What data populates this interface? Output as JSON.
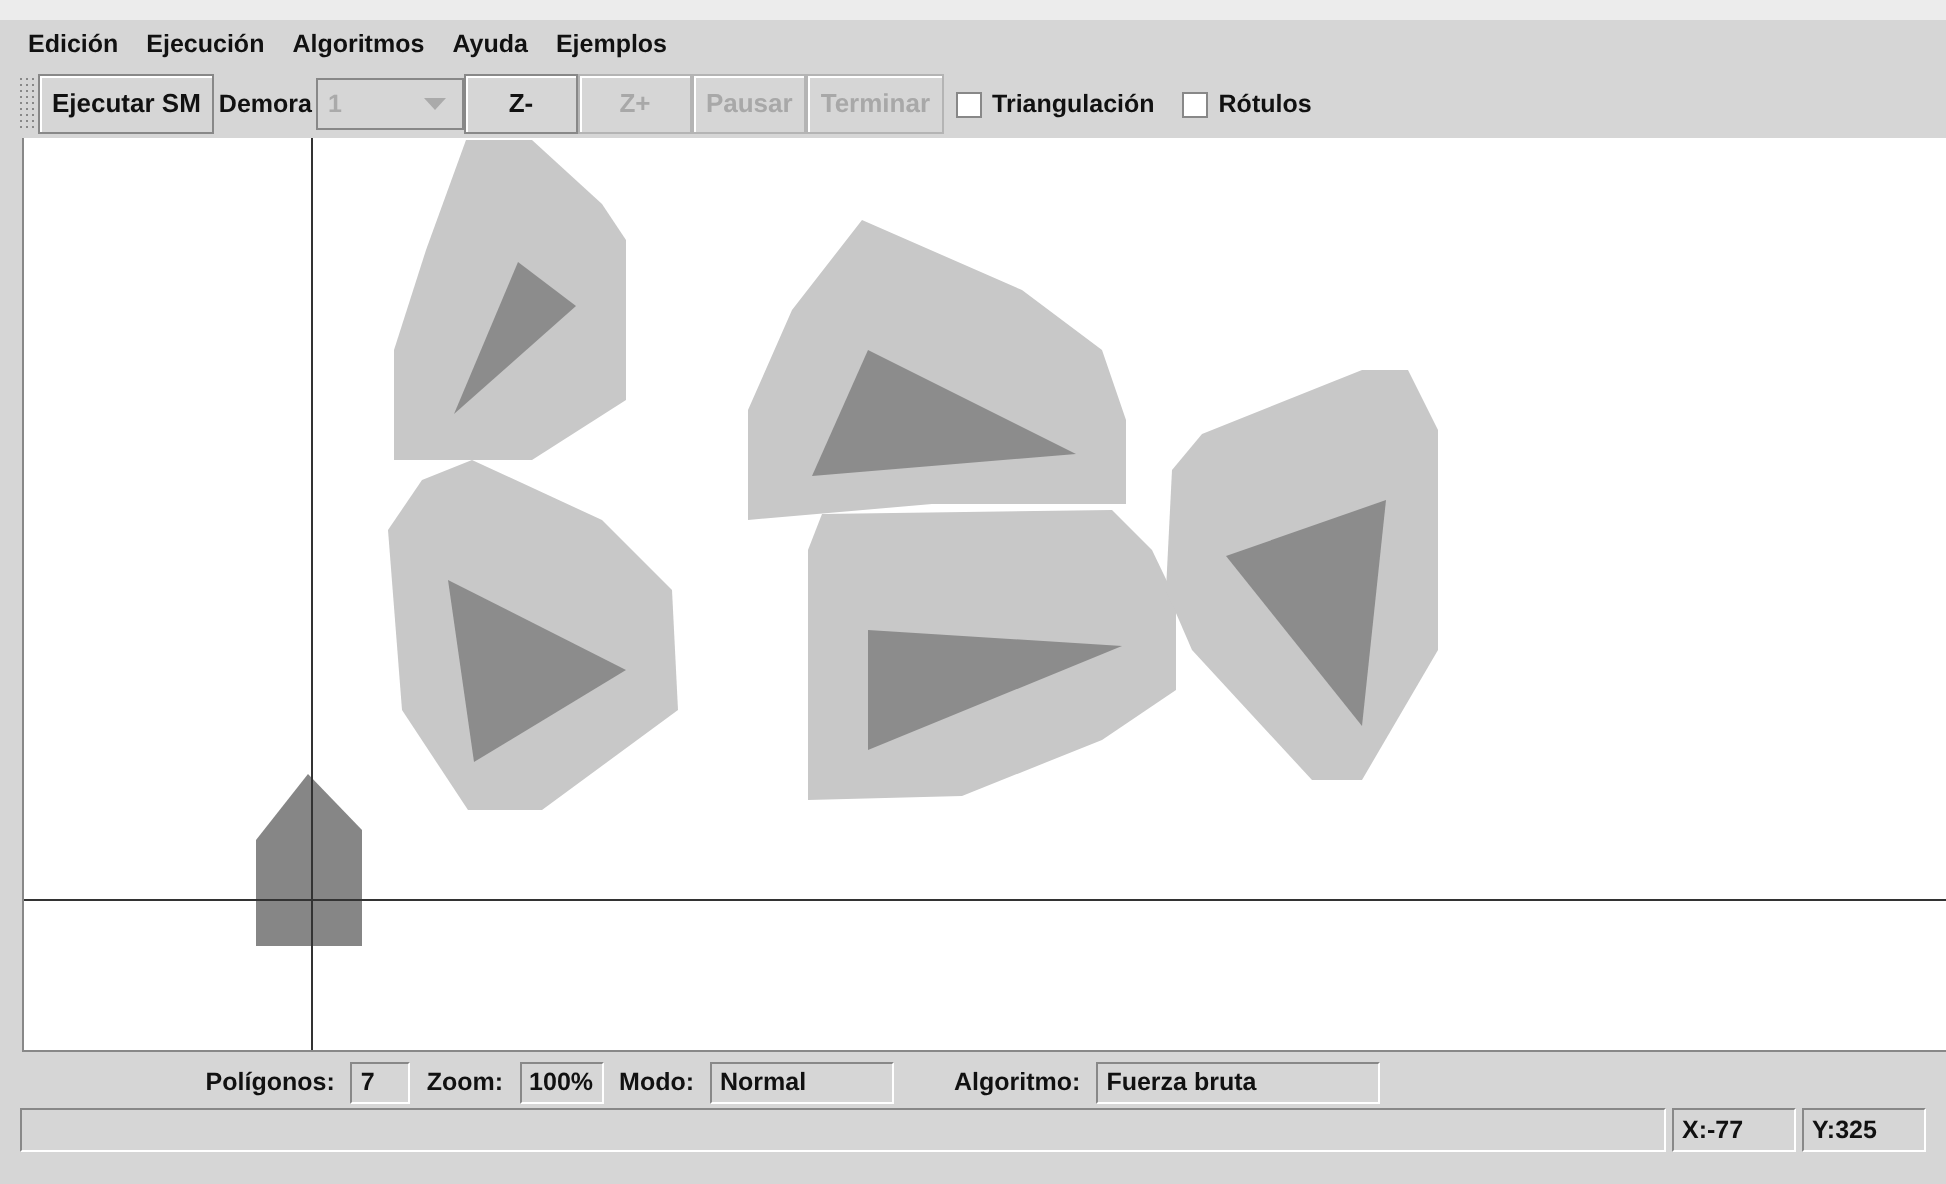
{
  "menu": [
    "Edición",
    "Ejecución",
    "Algoritmos",
    "Ayuda",
    "Ejemplos"
  ],
  "toolbar": [
    {
      "kind": "button",
      "label": "Ejecutar SM",
      "disabled": false
    },
    {
      "kind": "label",
      "label": "Demora"
    },
    {
      "kind": "combo",
      "value": "1",
      "disabled": true
    },
    {
      "kind": "button",
      "label": "Z-",
      "disabled": false
    },
    {
      "kind": "button",
      "label": "Z+",
      "disabled": true
    },
    {
      "kind": "button",
      "label": "Pausar",
      "disabled": true
    },
    {
      "kind": "button",
      "label": "Terminar",
      "disabled": true
    },
    {
      "kind": "checkbox",
      "label": "Triangulación",
      "checked": false
    },
    {
      "kind": "checkbox",
      "label": "Rótulos",
      "checked": false
    }
  ],
  "info_bar": [
    {
      "label": "Polígonos:",
      "value": "7"
    },
    {
      "label": "Zoom:",
      "value": "100%"
    },
    {
      "label": "Modo:",
      "value": "Normal"
    },
    {
      "label": "Algoritmo:",
      "value": "Fuerza bruta"
    }
  ],
  "status_bar": {
    "x": "X:-77",
    "y": "Y:325"
  }
}
